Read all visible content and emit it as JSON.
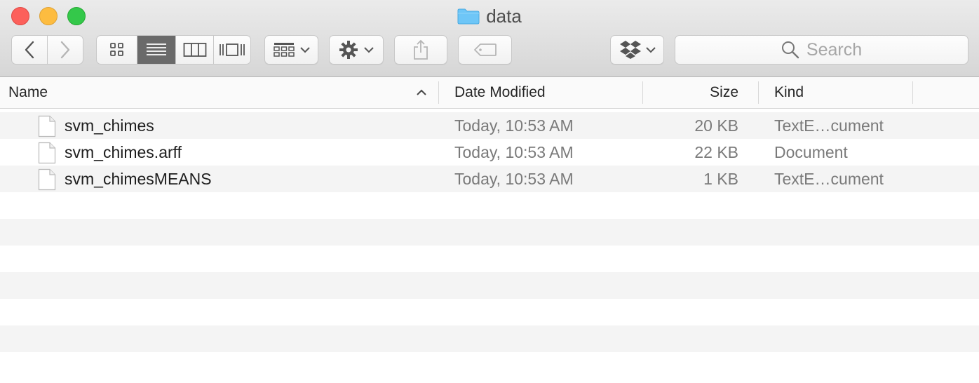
{
  "window": {
    "title": "data",
    "folder_color": "#6ec6f7"
  },
  "toolbar": {
    "back_icon": "chevron-left-icon",
    "forward_icon": "chevron-right-icon",
    "view_modes": [
      "icon-view-icon",
      "list-view-icon",
      "column-view-icon",
      "coverflow-view-icon"
    ],
    "active_view": "list",
    "arrange_icon": "arrange-icon",
    "action_icon": "gear-icon",
    "share_icon": "share-icon",
    "tags_icon": "tag-icon",
    "dropbox_icon": "dropbox-icon",
    "search_placeholder": "Search"
  },
  "columns": {
    "name": "Name",
    "date": "Date Modified",
    "size": "Size",
    "kind": "Kind",
    "sort_indicator": "^"
  },
  "files": [
    {
      "name": "svm_chimes",
      "date": "Today, 10:53 AM",
      "size": "20 KB",
      "kind": "TextE…cument"
    },
    {
      "name": "svm_chimes.arff",
      "date": "Today, 10:53 AM",
      "size": "22 KB",
      "kind": "Document"
    },
    {
      "name": "svm_chimesMEANS",
      "date": "Today, 10:53 AM",
      "size": "1 KB",
      "kind": "TextE…cument"
    }
  ],
  "colors": {
    "close": "#fc605b",
    "minimize": "#fdbc40",
    "maximize": "#34c84a",
    "stripe": "#f4f4f4",
    "active_segment": "#6a6a6a"
  }
}
